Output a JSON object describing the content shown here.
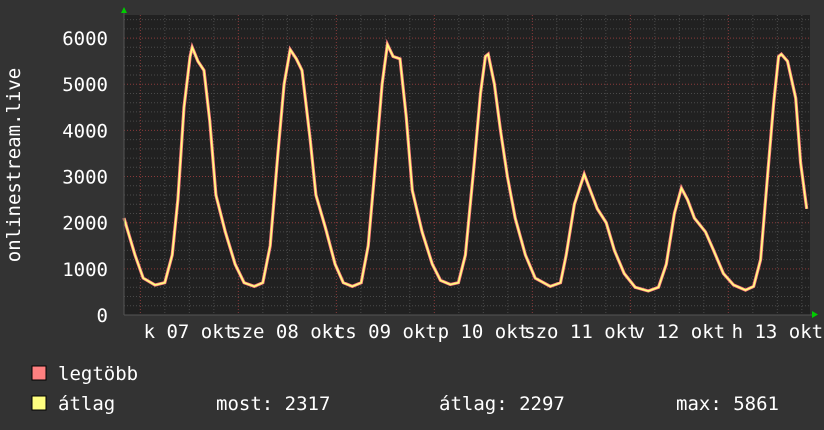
{
  "chart_data": {
    "type": "line",
    "ylabel": "onlinestream.live",
    "ylim": [
      0,
      6500
    ],
    "xlim_hours": [
      0,
      168
    ],
    "yticks": [
      0,
      1000,
      2000,
      3000,
      4000,
      5000,
      6000
    ],
    "ytick_labels": [
      "0",
      "1000",
      "2000",
      "3000",
      "4000",
      "5000",
      "6000"
    ],
    "xticks": [
      {
        "hour": 16,
        "label": "k 07 okt"
      },
      {
        "hour": 40,
        "label": "sze 08 okt"
      },
      {
        "hour": 64,
        "label": "cs 09 okt"
      },
      {
        "hour": 88,
        "label": "p 10 okt"
      },
      {
        "hour": 112,
        "label": "szo 11 okt"
      },
      {
        "hour": 136,
        "label": "v 12 okt"
      },
      {
        "hour": 160,
        "label": "h 13 okt"
      }
    ],
    "grid": true,
    "series": [
      {
        "name": "legtöbb",
        "color": "#ff8080"
      },
      {
        "name": "átlag",
        "color": "#ffff80"
      }
    ],
    "x": [
      0,
      2.7,
      4.7,
      7.6,
      10,
      11.8,
      13.2,
      14.7,
      16.2,
      16.7,
      18.1,
      19.6,
      21,
      22.5,
      24.8,
      27.2,
      29.4,
      31.9,
      34,
      35.8,
      37.7,
      39.2,
      40.7,
      42.2,
      43.6,
      45.6,
      47,
      49.3,
      51.7,
      53.7,
      55.9,
      58.1,
      59.8,
      61.8,
      63.2,
      64.5,
      65.9,
      67.6,
      69.1,
      70.6,
      73,
      75.5,
      77.5,
      79.9,
      81.9,
      83.6,
      85.8,
      87.3,
      88.5,
      89.2,
      90.7,
      92.2,
      93.9,
      95.8,
      98.3,
      100.7,
      104.4,
      106.9,
      108.3,
      110.3,
      112.7,
      114.2,
      115.9,
      118.1,
      120.1,
      122.5,
      125.2,
      128.4,
      130.9,
      132.8,
      134.8,
      136.5,
      138,
      139.7,
      142.4,
      144.4,
      146.8,
      149.3,
      152.2,
      154.2,
      155.9,
      157.6,
      159.1,
      160.3,
      161,
      162.5,
      164.5,
      165.7,
      167.2
    ],
    "values": [
      2100,
      1300,
      800,
      650,
      700,
      1300,
      2500,
      4500,
      5600,
      5800,
      5500,
      5300,
      4200,
      2600,
      1800,
      1100,
      700,
      620,
      700,
      1500,
      3500,
      5000,
      5750,
      5550,
      5300,
      3800,
      2600,
      1900,
      1100,
      700,
      620,
      700,
      1500,
      3500,
      5000,
      5860,
      5600,
      5550,
      4300,
      2700,
      1800,
      1100,
      750,
      660,
      700,
      1300,
      3300,
      4800,
      5600,
      5650,
      5000,
      4000,
      3000,
      2100,
      1300,
      800,
      620,
      700,
      1300,
      2400,
      3050,
      2700,
      2300,
      2000,
      1400,
      900,
      600,
      520,
      600,
      1100,
      2200,
      2750,
      2500,
      2100,
      1800,
      1400,
      900,
      650,
      540,
      620,
      1200,
      3000,
      4600,
      5600,
      5650,
      5500,
      4700,
      3300,
      2300
    ]
  },
  "legend": {
    "max_label": "legtöbb",
    "avg_label": "átlag",
    "now": "most: 2317",
    "average": "átlag: 2297",
    "maximum": "max: 5861"
  }
}
